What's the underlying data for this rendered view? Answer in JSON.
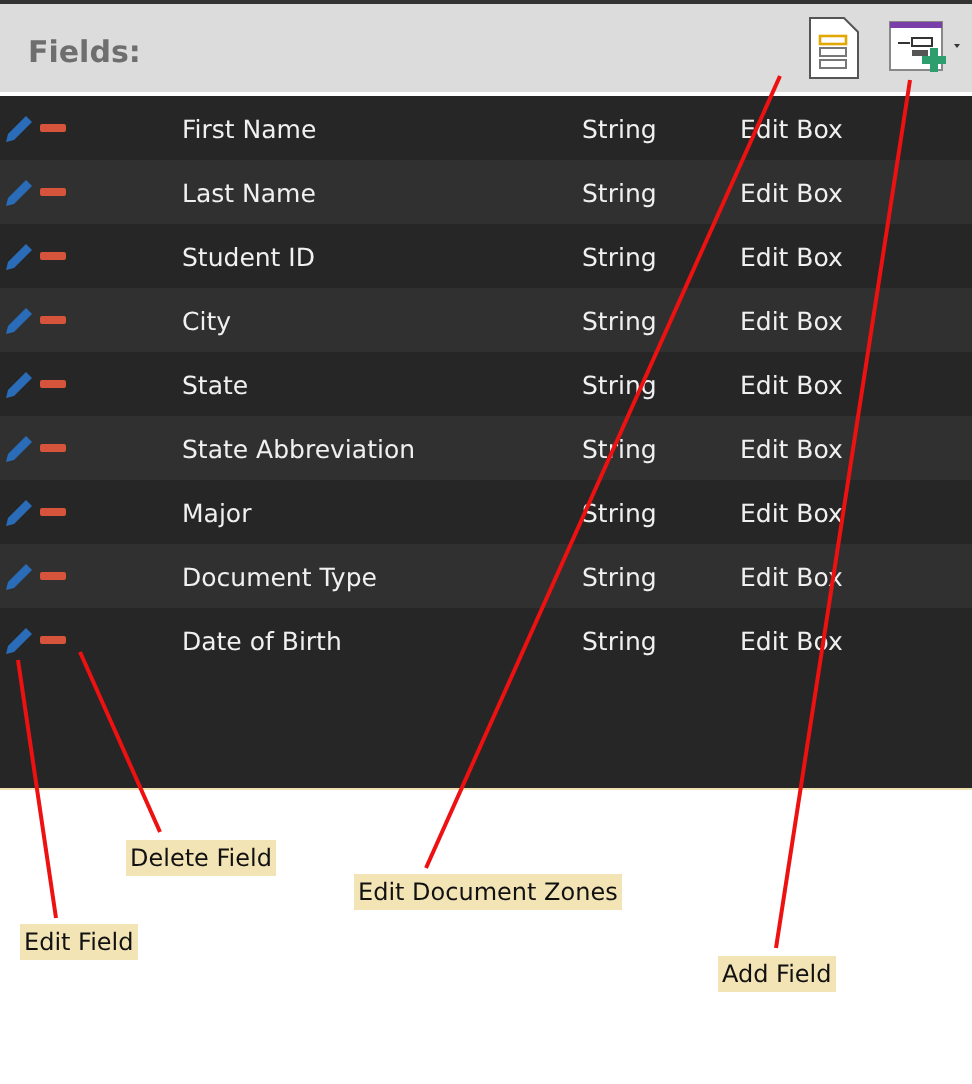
{
  "header": {
    "title": "Fields:"
  },
  "rows": [
    {
      "name": "First Name",
      "type": "String",
      "control": "Edit Box"
    },
    {
      "name": "Last Name",
      "type": "String",
      "control": "Edit Box"
    },
    {
      "name": "Student ID",
      "type": "String",
      "control": "Edit Box"
    },
    {
      "name": "City",
      "type": "String",
      "control": "Edit Box"
    },
    {
      "name": "State",
      "type": "String",
      "control": "Edit Box"
    },
    {
      "name": "State Abbreviation",
      "type": "String",
      "control": "Edit Box"
    },
    {
      "name": "Major",
      "type": "String",
      "control": "Edit Box"
    },
    {
      "name": "Document Type",
      "type": "String",
      "control": "Edit Box"
    },
    {
      "name": "Date of Birth",
      "type": "String",
      "control": "Edit Box"
    }
  ],
  "callouts": [
    {
      "text": "Delete Field"
    },
    {
      "text": "Edit Document Zones"
    },
    {
      "text": "Edit Field"
    },
    {
      "text": "Add Field"
    }
  ]
}
